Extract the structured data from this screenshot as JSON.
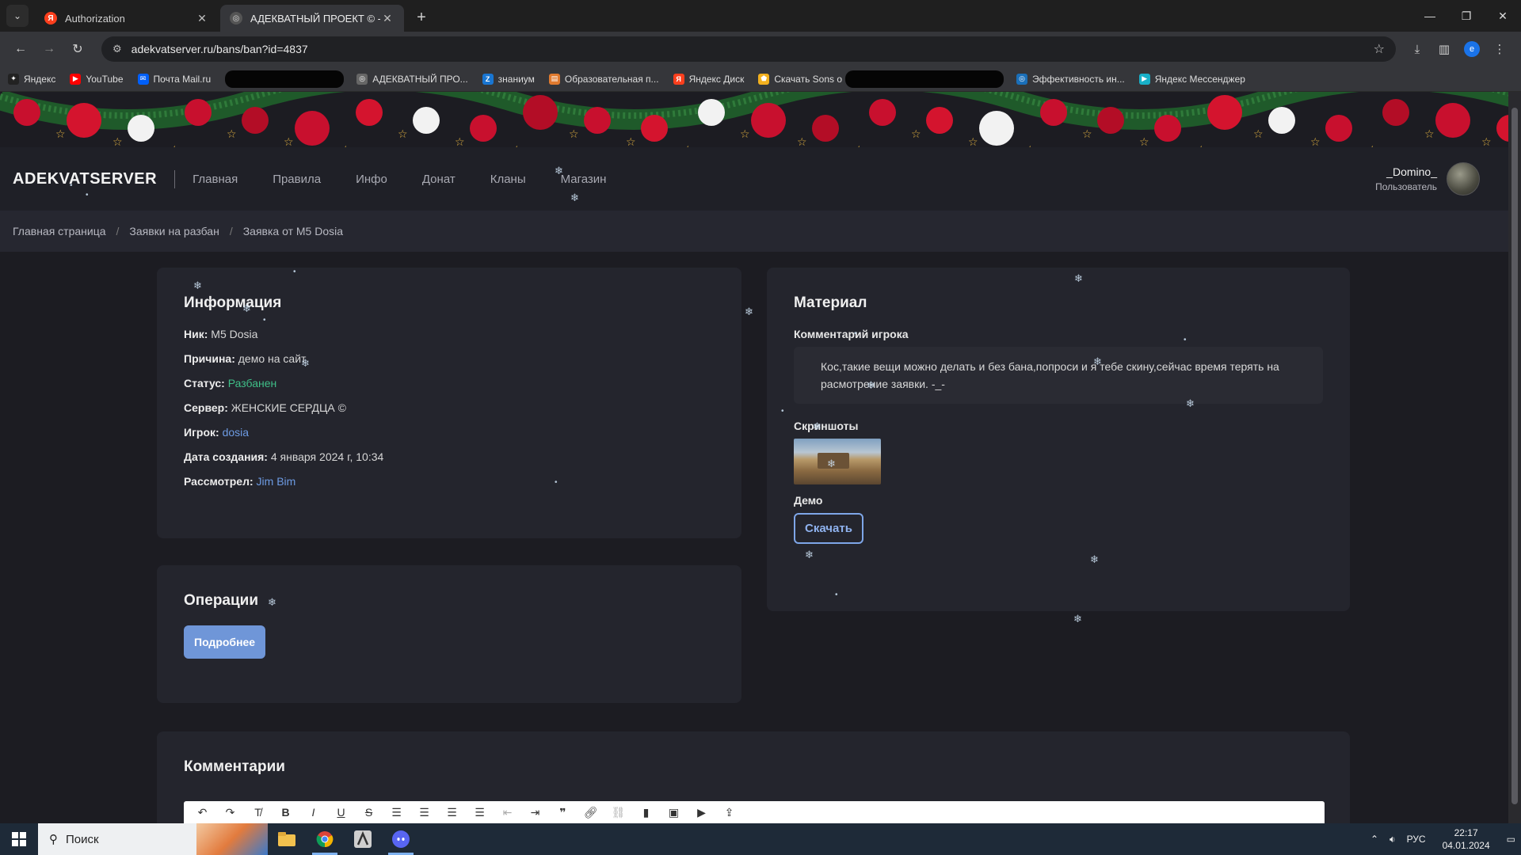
{
  "browser": {
    "tabs": [
      {
        "title": "Authorization",
        "favicon": "yandex-icon",
        "active": false
      },
      {
        "title": "АДЕКВАТНЫЙ ПРОЕКТ © - Зая",
        "favicon": "globe-icon",
        "active": true
      }
    ],
    "address": "adekvatserver.ru/bans/ban?id=4837",
    "bookmarks": [
      {
        "label": "Яндекс",
        "icon": "yandex-plus-icon",
        "color": "#222222"
      },
      {
        "label": "YouTube",
        "icon": "youtube-icon",
        "color": "#ff0000"
      },
      {
        "label": "Почта Mail.ru",
        "icon": "mail-icon",
        "color": "#005ff9"
      },
      {
        "label": "АДЕКВАТНЫЙ ПРО...",
        "icon": "globe-icon",
        "color": "#666666"
      },
      {
        "label": "знаниум",
        "icon": "znanium-icon",
        "color": "#1976d2"
      },
      {
        "label": "Образовательная п...",
        "icon": "edu-icon",
        "color": "#e07a2e"
      },
      {
        "label": "Яндекс Диск",
        "icon": "yandex-disk-icon",
        "color": "#fc3f1d"
      },
      {
        "label": "Скачать Sons o",
        "icon": "download-icon",
        "color": "#f2b01e"
      },
      {
        "label": "Эффективность ин...",
        "icon": "globe-icon",
        "color": "#1a6fb8"
      },
      {
        "label": "Яндекс Мессенджер",
        "icon": "messenger-icon",
        "color": "#18b0c9"
      }
    ]
  },
  "site": {
    "logo": "ADEKVATSERVER",
    "nav": [
      "Главная",
      "Правила",
      "Инфо",
      "Донат",
      "Кланы",
      "Магазин"
    ],
    "user": {
      "name": "_Domino_",
      "role": "Пользователь"
    }
  },
  "breadcrumbs": [
    "Главная страница",
    "Заявки на разбан",
    "Заявка от M5 Dosia"
  ],
  "info": {
    "title": "Информация",
    "nick_label": "Ник:",
    "nick": "M5 Dosia",
    "reason_label": "Причина:",
    "reason": "демо на сайт",
    "status_label": "Статус:",
    "status": "Разбанен",
    "server_label": "Сервер:",
    "server": "ЖЕНСКИЕ СЕРДЦА ©",
    "player_label": "Игрок:",
    "player": "dosia",
    "created_label": "Дата создания:",
    "created": "4 января 2024 г, 10:34",
    "reviewed_label": "Рассмотрел:",
    "reviewed": "Jim Bim"
  },
  "material": {
    "title": "Материал",
    "comment_label": "Комментарий игрока",
    "comment": "Кос,такие вещи можно делать и без бана,попроси и я тебе скину,сейчас время терять на расмотрение заявки. -_-",
    "screenshots_label": "Скриншоты",
    "demo_label": "Демо",
    "download": "Скачать"
  },
  "operations": {
    "title": "Операции",
    "details": "Подробнее"
  },
  "comments": {
    "title": "Комментарии"
  },
  "editor_tools": [
    "undo-icon",
    "redo-icon",
    "clear-format-icon",
    "bold-icon",
    "italic-icon",
    "underline-icon",
    "strikethrough-icon",
    "align-left-icon",
    "align-center-icon",
    "align-right-icon",
    "align-justify-icon",
    "outdent-icon",
    "indent-icon",
    "quote-icon",
    "link-icon",
    "unlink-icon",
    "bookmark-icon",
    "image-icon",
    "video-icon",
    "upload-icon"
  ],
  "taskbar": {
    "search": "Поиск",
    "lang": "РУС",
    "time": "22:17",
    "date": "04.01.2024"
  },
  "colors": {
    "status_green": "#3fbf88",
    "link_blue": "#6d9be3",
    "accent_button": "#6f96d8"
  }
}
